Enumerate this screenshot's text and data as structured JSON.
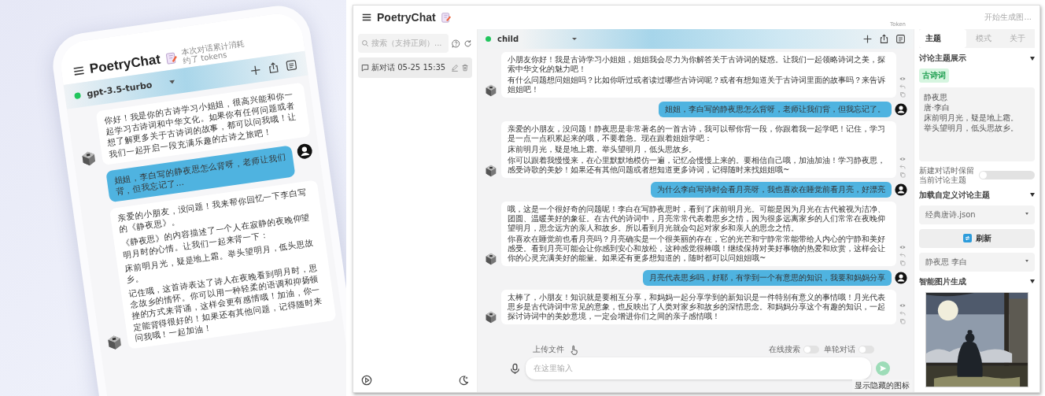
{
  "phone": {
    "app_title": "PoetryChat",
    "usage_note": "本次对话累计消耗",
    "token_note": "约了 tokens",
    "model": "gpt-3.5-turbo",
    "messages": [
      {
        "kind": "bot",
        "paragraphs": [
          "你好！我是你的古诗学习小姐姐，很高兴能和你一起学习古诗词和中华文化。如果你有任何问题或者想了解更多关于古诗词的故事，都可以问我哦！让我们一起开启一段充满乐趣的古诗之旅吧！"
        ]
      },
      {
        "kind": "user",
        "paragraphs": [
          "姐姐，李白写的静夜思怎么背呀，老师让我们背，但我忘记了…"
        ]
      },
      {
        "kind": "bot",
        "paragraphs": [
          "亲爱的小朋友，没问题！我来帮你回忆一下李白写的《静夜思》。",
          "《静夜思》的内容描述了一个人在寂静的夜晚仰望明月时的心情。让我们一起来背一下：",
          "床前明月光，疑是地上霜。举头望明月，低头思故乡。",
          "记住哦，这首诗表达了诗人在夜晚看到明月时，思念故乡的情怀。你可以用一种轻柔的语调和抑扬顿挫的方式来背诵，这样会更有感情哦！加油，你一定能背得很好的！如果还有其他问题，记得随时来问我哦！一起加油！"
        ]
      }
    ]
  },
  "window": {
    "app_title": "PoetryChat",
    "token_note": "Token"
  },
  "sidebar": {
    "search": {
      "placeholder": "搜索（支持正则）..."
    },
    "conversations": [
      {
        "title": "新对话 05-25 15:35",
        "selected": true
      }
    ]
  },
  "chat": {
    "model": "child",
    "messages": [
      {
        "kind": "bot",
        "paragraphs": [
          "小朋友你好！我是古诗学习小姐姐，姐姐我会尽力为你解答关于古诗词的疑惑。让我们一起领略诗词之美，探索中华文化的魅力吧！",
          "有什么问题想问姐姐吗？比如你听过或者读过哪些古诗词呢？或者有想知道关于古诗词里面的故事吗？来告诉姐姐吧！"
        ]
      },
      {
        "kind": "user",
        "paragraphs": [
          "姐姐，李白写的静夜思怎么背呀，老师让我们背，但我忘记了。"
        ]
      },
      {
        "kind": "bot",
        "paragraphs": [
          "亲爱的小朋友，没问题！静夜思是非常著名的一首古诗，我可以帮你背一段，你跟着我一起学吧！记住，学习是一点一点积累起来的哦，不要着急。现在跟着姐姐学吧：",
          "床前明月光，疑是地上霜。举头望明月，低头思故乡。",
          "你可以跟着我慢慢来，在心里默默地模仿一遍，记忆会慢慢上来的。要相信自己哦，加油加油！学习静夜思，感受诗歌的美妙！如果还有其他问题或者想知道更多诗词，记得随时来找姐姐哦~"
        ]
      },
      {
        "kind": "user",
        "paragraphs": [
          "为什么李白写诗时会看月亮呀，我也喜欢在睡觉前看月亮，好漂亮"
        ]
      },
      {
        "kind": "bot",
        "paragraphs": [
          "哦，这是一个很好奇的问题呢！李白在写静夜思时，看到了床前明月光。可能是因为月光在古代被视为洁净、团圆、温暖美好的象征。在古代的诗词中，月亮常常代表着思乡之情，因为很多远离家乡的人们常常在夜晚仰望明月，思念远方的亲人和故乡。所以看到月光就会勾起对家乡和亲人的思念之情。",
          "你喜欢在睡觉前也看月亮吗？月亮确实是一个很美丽的存在，它的光芒和宁静常常能带给人内心的宁静和美好感受。看到月亮可能会让你感到安心和放松，这种感觉很棒哦！继续保持对美好事物的热爱和欣赏，这样会让你的心灵充满美好的能量。如果还有更多想知道的，随时都可以问姐姐哦~"
        ]
      },
      {
        "kind": "user",
        "paragraphs": [
          "月亮代表思乡吗，好耶，有学到一个有意思的知识，我要和妈妈分享"
        ]
      },
      {
        "kind": "bot",
        "paragraphs": [
          "太棒了，小朋友！知识就是要相互分享，和妈妈一起分享学到的新知识是一件特别有意义的事情哦！月光代表思乡是古代诗词中常见的意象，也反映出了人类对家乡和故乡的深情思念。和妈妈分享这个有趣的知识，一起探讨诗词中的美妙意境，一定会增进你们之间的亲子感情哦！"
        ]
      }
    ]
  },
  "composer": {
    "upload_label": "上传文件",
    "toggles": [
      {
        "label": "在线搜索",
        "on": false
      },
      {
        "label": "单轮对话",
        "on": false
      }
    ],
    "placeholder": "在这里输入",
    "tooltip": "显示隐藏的图标"
  },
  "settings": {
    "top_note": "开始生成图...",
    "tabs": [
      {
        "label": "主题",
        "selected": true
      },
      {
        "label": "模式",
        "selected": false
      },
      {
        "label": "关于",
        "selected": false
      }
    ],
    "items": [
      {
        "kind": "heading",
        "label": "讨论主题展示",
        "expanded": true
      },
      {
        "kind": "tag",
        "label": "古诗词"
      },
      {
        "kind": "textarea",
        "lines": [
          "静夜思",
          "唐·李白",
          "床前明月光，疑是地上霜。",
          "举头望明月，低头思故乡。"
        ]
      },
      {
        "kind": "toggle",
        "label": "新建对话时保留当前讨论主题",
        "on": false
      },
      {
        "kind": "heading",
        "label": "加载自定义讨论主题",
        "expanded": true
      },
      {
        "kind": "select",
        "value": "经典唐诗.json"
      },
      {
        "kind": "button",
        "label": "刷新"
      },
      {
        "kind": "select",
        "value": "静夜思 李白"
      },
      {
        "kind": "heading",
        "label": "智能图片生成",
        "expanded": true
      },
      {
        "kind": "picture"
      }
    ]
  }
}
